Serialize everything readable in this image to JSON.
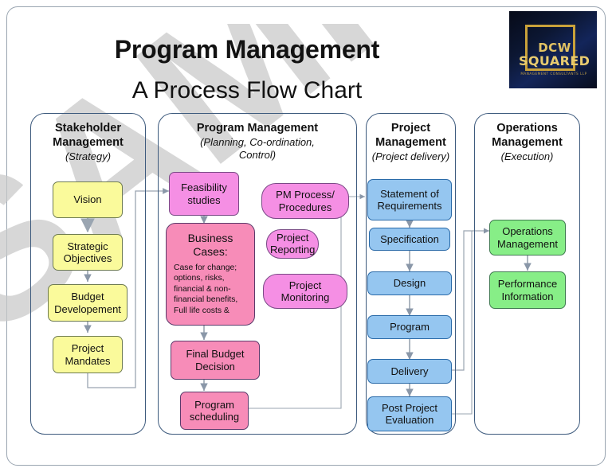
{
  "title": {
    "main": "Program Management",
    "sub": "A Process Flow Chart"
  },
  "watermark": {
    "text": "SAMPLE"
  },
  "logo": {
    "name": "DCW",
    "word": "SQUARED",
    "tagline": "MANAGEMENT CONSULTANTS LLP"
  },
  "lanes": [
    {
      "title": "Stakeholder\nManagement",
      "title_line1": "Stakeholder",
      "title_line2": "Management",
      "subtitle": "(Strategy)",
      "color": "#fafa9b",
      "boxes": [
        {
          "label": "Vision"
        },
        {
          "label": "Strategic\nObjectives",
          "line1": "Strategic",
          "line2": "Objectives"
        },
        {
          "label": "Budget\nDevelopement",
          "line1": "Budget",
          "line2": "Developement"
        },
        {
          "label": "Project\nMandates",
          "line1": "Project",
          "line2": "Mandates"
        }
      ]
    },
    {
      "title_line1": "Program Management",
      "title_line2": "",
      "subtitle": "(Planning, Co-ordination,",
      "subtitle2": "Control)",
      "color": "#f78cb8",
      "boxes": [
        {
          "label": "Feasibility\nstudies",
          "line1": "Feasibility",
          "line2": "studies"
        },
        {
          "title": "Business\nCases:",
          "title_line1": "Business",
          "title_line2": "Cases:",
          "detail": "Case for change; options, risks, financial & non-financial benefits, Full life costs &"
        },
        {
          "label": "Final Budget\nDecision",
          "line1": "Final Budget",
          "line2": "Decision"
        },
        {
          "label": "Program\nscheduling",
          "line1": "Program",
          "line2": "scheduling"
        }
      ],
      "side_boxes": [
        {
          "line1": "PM Process/",
          "line2": "Procedures"
        },
        {
          "line1": "Project",
          "line2": "Reporting"
        },
        {
          "line1": "Project",
          "line2": "Monitoring"
        }
      ]
    },
    {
      "title_line1": "Project",
      "title_line2": "Management",
      "subtitle": "(Project delivery)",
      "color": "#95c6f0",
      "boxes": [
        {
          "line1": "Statement of",
          "line2": "Requirements"
        },
        {
          "line1": "Specification",
          "line2": ""
        },
        {
          "line1": "Design",
          "line2": ""
        },
        {
          "line1": "Program",
          "line2": ""
        },
        {
          "line1": "Delivery",
          "line2": ""
        },
        {
          "line1": "Post Project",
          "line2": "Evaluation"
        }
      ]
    },
    {
      "title_line1": "Operations",
      "title_line2": "Management",
      "subtitle": "(Execution)",
      "color": "#87ee87",
      "boxes": [
        {
          "line1": "Operations",
          "line2": "Management"
        },
        {
          "line1": "Performance",
          "line2": "Information"
        }
      ]
    }
  ],
  "colors": {
    "frame_border": "#9aa5b1",
    "lane_border": "#3d5a7d",
    "yellow": "#fafa9b",
    "magenta": "#f58fe4",
    "pink": "#f78cb8",
    "blue": "#95c6f0",
    "green": "#87ee87",
    "arrow": "#8a97a8",
    "watermark": "#c9c9c9",
    "logo_gold": "#e3c363",
    "logo_bg": "#0c1733"
  }
}
